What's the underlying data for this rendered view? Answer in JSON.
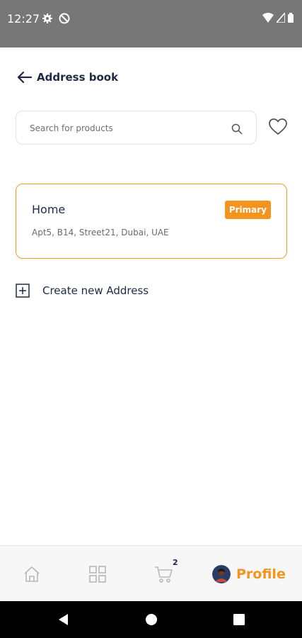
{
  "status_bar": {
    "time": "12:27",
    "icons": [
      "gear-icon",
      "data-saver-icon",
      "wifi-icon",
      "signal-icon",
      "battery-icon"
    ]
  },
  "header": {
    "title": "Address book",
    "back_icon": "arrow-left-icon"
  },
  "search": {
    "placeholder": "Search for products",
    "value": "",
    "icon": "search-icon"
  },
  "favorites_icon": "heart-icon",
  "addresses": [
    {
      "name": "Home",
      "badge": "Primary",
      "detail": "Apt5, B14, Street21, Dubai, UAE"
    }
  ],
  "create_address": {
    "label": "Create new Address",
    "icon": "plus-square-icon"
  },
  "bottom_nav": {
    "items": [
      {
        "icon": "home-icon",
        "active": false
      },
      {
        "icon": "grid-icon",
        "active": false
      },
      {
        "icon": "cart-icon",
        "badge": "2",
        "active": false
      },
      {
        "icon": "avatar",
        "label": "Profile",
        "active": true
      }
    ]
  },
  "system_nav": [
    "back-triangle-icon",
    "home-circle-icon",
    "recents-square-icon"
  ],
  "colors": {
    "accent": "#f2941e",
    "text_primary": "#1f2a44",
    "text_secondary": "#6b6b6b",
    "status_bar": "#777777",
    "card_border": "#f29b20"
  }
}
